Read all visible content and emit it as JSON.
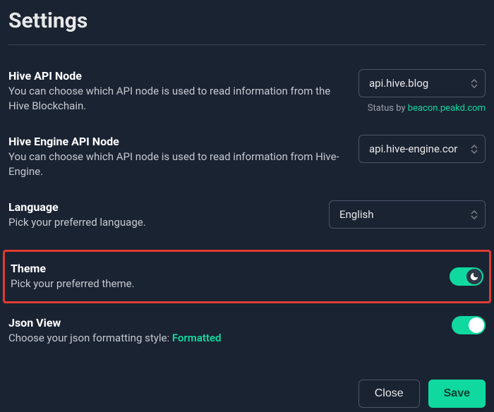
{
  "title": "Settings",
  "sections": {
    "hiveApi": {
      "label": "Hive API Node",
      "desc": "You can choose which API node is used to read information from the Hive Blockchain.",
      "value": "api.hive.blog",
      "statusPrefix": "Status by ",
      "statusLink": "beacon.peakd.com"
    },
    "hiveEngine": {
      "label": "Hive Engine API Node",
      "desc": "You can choose which API node is used to read information from Hive-Engine.",
      "value": "api.hive-engine.cor"
    },
    "language": {
      "label": "Language",
      "desc": "Pick your preferred language.",
      "value": "English"
    },
    "theme": {
      "label": "Theme",
      "desc": "Pick your preferred theme."
    },
    "jsonView": {
      "label": "Json View",
      "descPrefix": "Choose your json formatting style: ",
      "descValue": "Formatted"
    }
  },
  "buttons": {
    "close": "Close",
    "save": "Save"
  }
}
